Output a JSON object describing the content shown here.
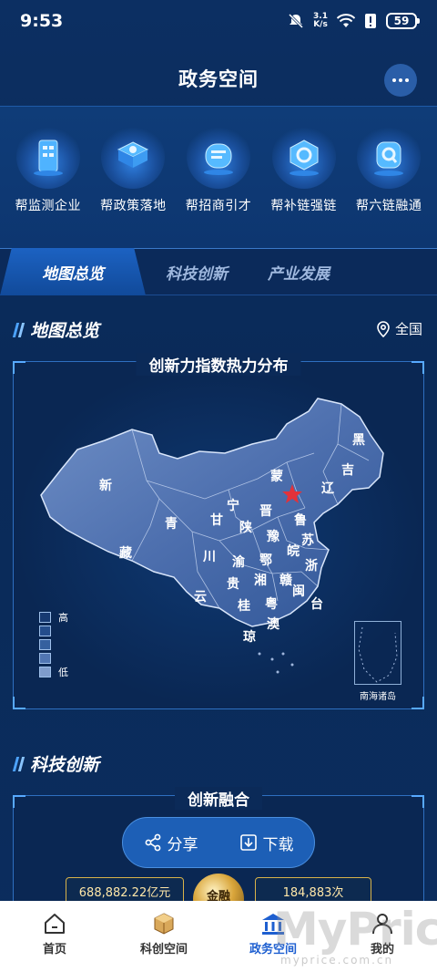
{
  "status_bar": {
    "time": "9:53",
    "speed": "3.1\nK/s",
    "speed_value": "3.1",
    "speed_unit": "K/s",
    "battery": "59"
  },
  "header": {
    "title": "政务空间"
  },
  "quick_links": [
    {
      "label": "帮监测企业",
      "icon": "building-icon"
    },
    {
      "label": "帮政策落地",
      "icon": "policy-icon"
    },
    {
      "label": "帮招商引才",
      "icon": "recruit-icon"
    },
    {
      "label": "帮补链强链",
      "icon": "chain-icon"
    },
    {
      "label": "帮六链融通",
      "icon": "link-icon"
    }
  ],
  "tabs": [
    {
      "label": "地图总览",
      "active": true
    },
    {
      "label": "科技创新",
      "active": false
    },
    {
      "label": "产业发展",
      "active": false
    }
  ],
  "map_section": {
    "title": "地图总览",
    "region": "全国",
    "panel_title": "创新力指数热力分布",
    "legend": {
      "high": "高",
      "low": "低",
      "colors": [
        "#173a72",
        "#244d8c",
        "#35609f",
        "#5176b3",
        "#7f9ccc"
      ]
    },
    "provinces": [
      "黑",
      "吉",
      "辽",
      "蒙",
      "新",
      "青",
      "藏",
      "甘",
      "宁",
      "陕",
      "晋",
      "鲁",
      "豫",
      "苏",
      "皖",
      "川",
      "渝",
      "鄂",
      "浙",
      "湘",
      "赣",
      "贵",
      "云",
      "闽",
      "桂",
      "粤",
      "台",
      "琼",
      "澳"
    ],
    "inset_label": "南海诸岛"
  },
  "tech_section": {
    "title": "科技创新",
    "panel_title": "创新融合",
    "share_label": "分享",
    "download_label": "下载",
    "stat_left": "688,882.22亿元",
    "stat_right": "184,883次",
    "orb_label": "金融"
  },
  "bottom_nav": [
    {
      "label": "首页",
      "icon": "home-icon",
      "active": false
    },
    {
      "label": "科创空间",
      "icon": "cube-icon",
      "active": false
    },
    {
      "label": "政务空间",
      "icon": "government-icon",
      "active": true
    },
    {
      "label": "我的",
      "icon": "user-icon",
      "active": false
    }
  ],
  "watermark": {
    "text": "MyPrice",
    "sub": "myprice.com.cn"
  }
}
